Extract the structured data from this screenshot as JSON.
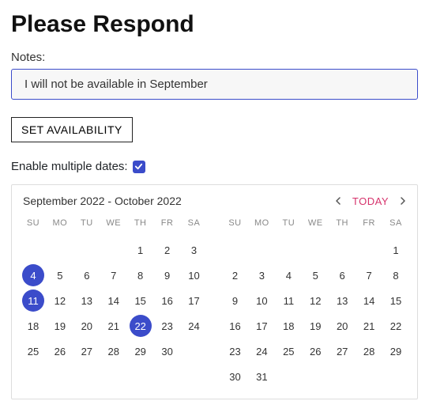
{
  "header": {
    "title": "Please Respond"
  },
  "notes": {
    "label": "Notes:",
    "value": "I will not be available in September"
  },
  "actions": {
    "set_availability_label": "SET AVAILABILITY"
  },
  "multi": {
    "label": "Enable multiple dates:",
    "checked": true
  },
  "calendar": {
    "range_label": "September 2022 - October 2022",
    "today_label": "TODAY",
    "weekdays": [
      "SU",
      "MO",
      "TU",
      "WE",
      "TH",
      "FR",
      "SA"
    ],
    "months": [
      {
        "name": "September 2022",
        "lead_empty": 4,
        "days": 30,
        "selected": [
          4,
          11,
          22
        ]
      },
      {
        "name": "October 2022",
        "lead_empty": 6,
        "days": 31,
        "selected": []
      }
    ]
  }
}
